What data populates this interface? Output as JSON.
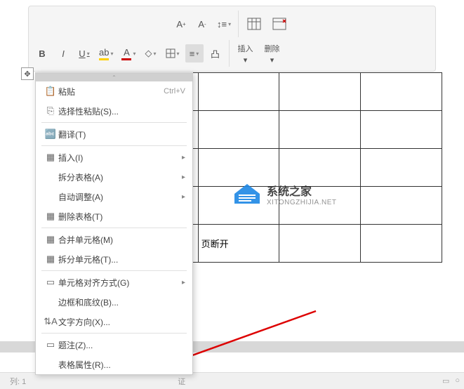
{
  "toolbar": {
    "big": {
      "insert": "插入",
      "delete": "删除"
    }
  },
  "contextMenu": {
    "paste": {
      "label": "粘贴",
      "shortcut": "Ctrl+V"
    },
    "pasteSpecial": "选择性粘贴(S)...",
    "translate": "翻译(T)",
    "insert": "插入(I)",
    "splitTable": "拆分表格(A)",
    "autoFit": "自动调整(A)",
    "deleteTable": "删除表格(T)",
    "mergeCells": "合并单元格(M)",
    "splitCells": "拆分单元格(T)...",
    "cellAlign": "单元格对齐方式(G)",
    "borderShading": "边框和底纹(B)...",
    "textDirection": "文字方向(X)...",
    "caption": "题注(Z)...",
    "tableProps": "表格属性(R)..."
  },
  "table": {
    "cellText": "页断开"
  },
  "watermark": {
    "title": "系统之家",
    "sub": "XITONGZHIJIA.NET"
  },
  "statusBar": {
    "row": "列: 1",
    "verify": "证"
  }
}
